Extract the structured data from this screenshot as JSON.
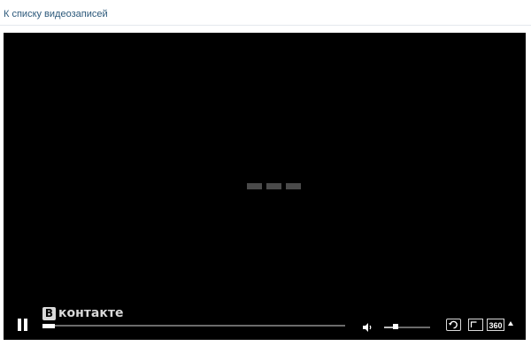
{
  "header": {
    "back_link": "К списку видеозаписей"
  },
  "player": {
    "state": "loading",
    "watermark": {
      "badge": "В",
      "text": "контакте"
    },
    "progress_fraction": 0.04,
    "volume_fraction": 0.2,
    "quality_label": "360",
    "icons": {
      "play_pause": "pause-icon",
      "volume": "speaker-icon",
      "repeat": "repeat-icon",
      "expand": "expand-icon",
      "quality_menu": "caret-up-icon"
    },
    "colors": {
      "background": "#000000",
      "controls": "#ffffff",
      "link": "#2b587a"
    }
  }
}
